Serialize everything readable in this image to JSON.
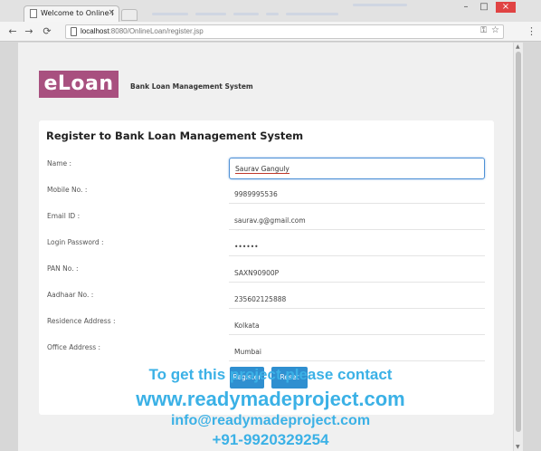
{
  "browser": {
    "tab_title": "Welcome to Online Loan",
    "tab_close": "×",
    "url_host": "localhost",
    "url_path": ":8080/OnlineLoan/register.jsp",
    "min_glyph": "–",
    "max_glyph": "□",
    "close_glyph": "×",
    "back_glyph": "←",
    "forward_glyph": "→",
    "reload_glyph": "⟳",
    "key_glyph": "⚿",
    "star_glyph": "☆",
    "menu_glyph": "⋮"
  },
  "header": {
    "logo": "eLoan",
    "tagline": "Bank Loan Management System"
  },
  "form": {
    "title": "Register to Bank Loan Management System",
    "fields": [
      {
        "label": "Name :",
        "value": "Saurav Ganguly"
      },
      {
        "label": "Mobile No. :",
        "value": "9989995536"
      },
      {
        "label": "Email ID :",
        "value": "saurav.g@gmail.com"
      },
      {
        "label": "Login Password :",
        "value": "••••••"
      },
      {
        "label": "PAN No. :",
        "value": "SAXN90900P"
      },
      {
        "label": "Aadhaar No. :",
        "value": "235602125888"
      },
      {
        "label": "Residence Address :",
        "value": "Kolkata"
      },
      {
        "label": "Office Address :",
        "value": "Mumbai"
      }
    ],
    "register_label": "Register",
    "reset_label": "Reset"
  },
  "watermark": {
    "line1": "To get this project please contact",
    "line2": "www.readymadeproject.com",
    "line3": "info@readymadeproject.com",
    "line4": "+91-9920329254"
  },
  "colors": {
    "logo_bg": "#a8507f",
    "button_bg": "#2f8fd0",
    "watermark": "#3bb1e6",
    "focus_border": "#4d90d6"
  }
}
